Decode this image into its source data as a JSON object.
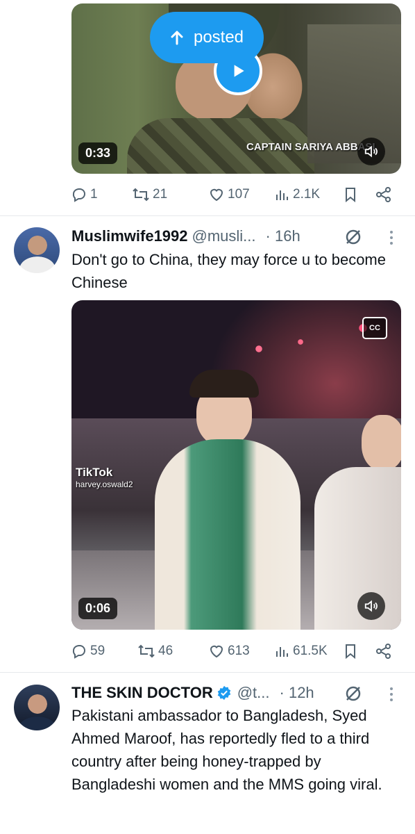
{
  "tweet1": {
    "duration": "0:33",
    "posted_label": "posted",
    "caption_overlay": "CAPTAIN SARIYA ABBASI",
    "stats": {
      "replies": "1",
      "reposts": "21",
      "likes": "107",
      "views": "2.1K"
    }
  },
  "tweet2": {
    "author": "Muslimwife1992",
    "handle": "@musli...",
    "time": "· 16h",
    "text": "Don't go to China, they may force u to become Chinese",
    "cc_label": "CC",
    "watermark": "TikTok",
    "watermark_user": "harvey.oswald2",
    "duration": "0:06",
    "stats": {
      "replies": "59",
      "reposts": "46",
      "likes": "613",
      "views": "61.5K"
    }
  },
  "tweet3": {
    "author": "THE SKIN DOCTOR",
    "verified": true,
    "handle": "@t...",
    "time": "· 12h",
    "text": "Pakistani ambassador to Bangladesh, Syed Ahmed Maroof, has reportedly fled to a third country after being honey-trapped by Bangladeshi women and the MMS going viral."
  },
  "colors": {
    "accent": "#1d9bf0",
    "text_primary": "#0f1419",
    "text_secondary": "#536471",
    "divider": "#e6e9ec",
    "verified": "#1d9bf0"
  },
  "icons": [
    "reply-icon",
    "repost-icon",
    "like-icon",
    "views-icon",
    "bookmark-icon",
    "share-icon",
    "grok-icon",
    "more-icon",
    "play-icon",
    "sound-icon",
    "verified-icon",
    "arrow-up-icon"
  ]
}
